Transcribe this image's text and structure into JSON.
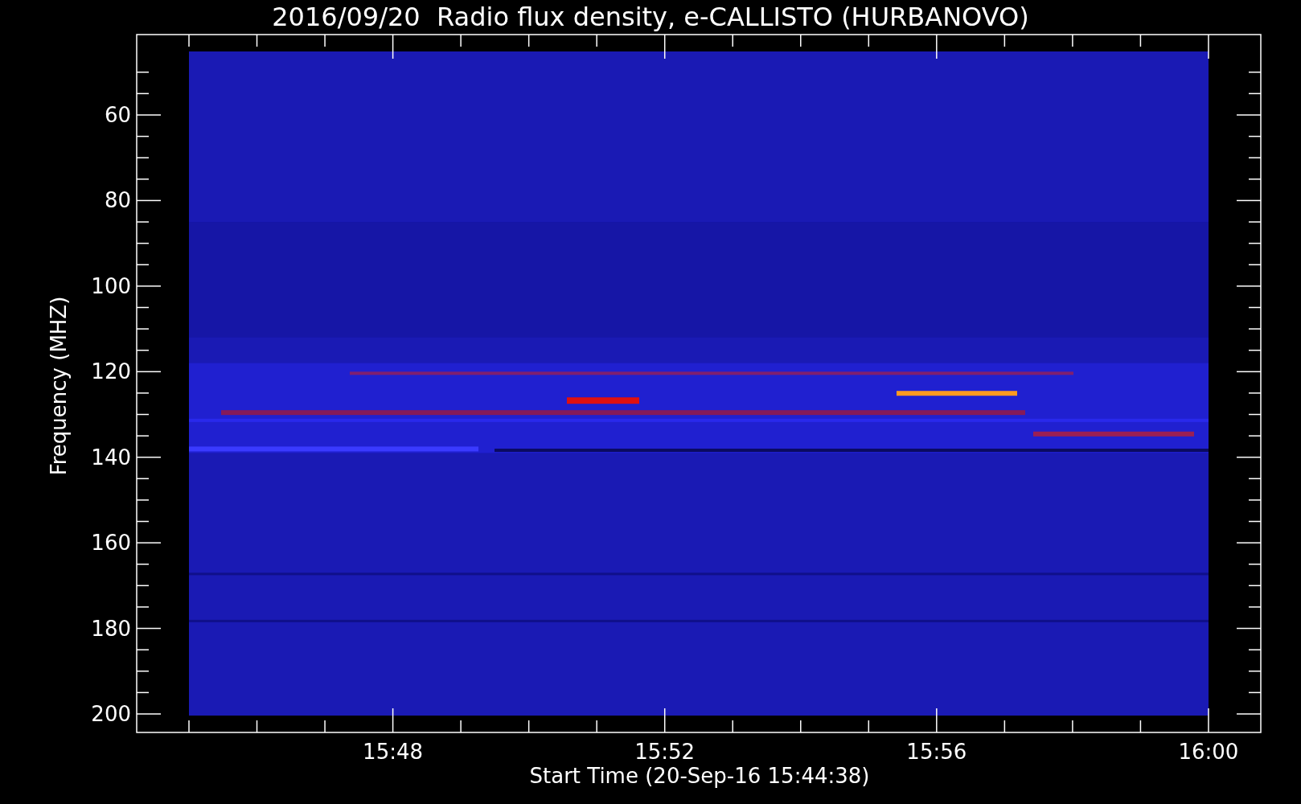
{
  "title": "2016/09/20  Radio flux density, e-CALLISTO (HURBANOVO)",
  "y_axis": {
    "label": "Frequency (MHZ)",
    "ticks": [
      "60",
      "80",
      "100",
      "120",
      "140",
      "160",
      "180",
      "200"
    ]
  },
  "x_axis": {
    "label": "Start Time (20-Sep-16 15:44:38)",
    "ticks": [
      "15:48",
      "15:52",
      "15:56",
      "16:00"
    ]
  }
}
